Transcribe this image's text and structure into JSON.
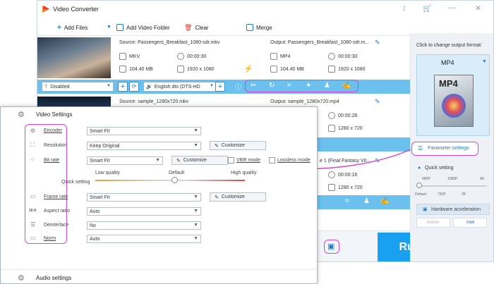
{
  "app": {
    "title": "Video Converter",
    "toolbar": {
      "add_files": "Add Files",
      "add_folder": "Add Video Folder",
      "clear": "Clear",
      "merge": "Merge"
    },
    "files": [
      {
        "source": "Source: Passengers_Breakfast_1080-sdr.mkv",
        "output": "Output: Passengers_Breakfast_1080-sdr.m...",
        "src_format": "MKV",
        "src_duration": "00:00:30",
        "src_size": "104.40 MB",
        "src_res": "1920 x 1080",
        "out_format": "MP4",
        "out_duration": "00:00:30",
        "out_size": "104.40 MB",
        "out_res": "1920 x 1080"
      },
      {
        "source": "Source: sample_1280x720.mkv",
        "output": "Output: sample_1280x720.mp4",
        "out_duration": "00:00:28",
        "out_res": "1280 x 720"
      },
      {
        "output": "e 1 (Final Fantasy VII...",
        "out_duration": "00:00:16",
        "out_res": "1280 x 720"
      }
    ],
    "subtitle_select": "Disabled",
    "audio_select": "English dts (DTS-HD",
    "right": {
      "hint": "Click to change output format:",
      "format": "MP4",
      "format_icon_text": "MP4",
      "param_settings": "Parameter settings",
      "quick_setting": "Quick setting",
      "quality_ticks": [
        "480P",
        "1080P",
        "4K"
      ],
      "quality_ticks_bottom": [
        "Default",
        "720P",
        "2K"
      ],
      "hw_accel": "Hardware acceleration",
      "nvidia": "NVIDIA",
      "intel": "Intel"
    },
    "run": "Run",
    "colors": {
      "accent": "#1aa0f0",
      "highlight": "#d845d8",
      "bluebar": "#6bc0ee"
    }
  },
  "dialog": {
    "video_title": "Video Settings",
    "audio_title": "Audio settings",
    "rows": {
      "encoder": {
        "label": "Encoder",
        "value": "Smart Fit"
      },
      "resolution": {
        "label": "Resolution",
        "value": "Keep Original",
        "custom": "Customize"
      },
      "bitrate": {
        "label": "Bit rate",
        "value": "Smart Fit",
        "custom": "Customize",
        "vbr": "VBR mode",
        "lossless": "Lossless mode"
      },
      "frame_rate": {
        "label": "Frame rate",
        "value": "Smart Fit",
        "custom": "Customize"
      },
      "aspect": {
        "label": "Aspect ratio",
        "value": "Auto",
        "icon_text": "16:9"
      },
      "deinterlace": {
        "label": "Deinterlace",
        "value": "No"
      },
      "norm": {
        "label": "Norm",
        "value": "Auto"
      }
    },
    "quality": {
      "quick_label": "Quick setting",
      "low": "Low quality",
      "default": "Default",
      "high": "High quality"
    }
  }
}
